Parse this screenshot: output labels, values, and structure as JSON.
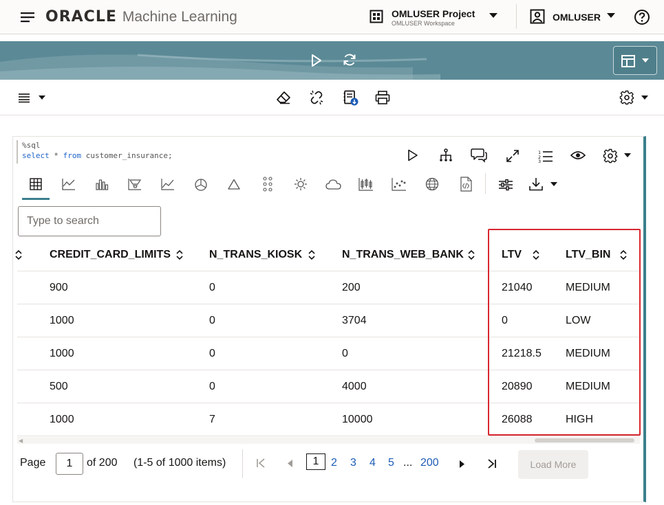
{
  "header": {
    "brand": "ORACLE",
    "product": "Machine Learning",
    "project_name": "OMLUSER Project",
    "workspace_name": "OMLUSER Workspace",
    "user_name": "OMLUSER"
  },
  "paragraph": {
    "code_line1": "%sql",
    "code_select": "select",
    "code_mid": " * ",
    "code_from": "from",
    "code_table": " customer_insurance;",
    "search_placeholder": "Type to search"
  },
  "table": {
    "columns": [
      "CREDIT_CARD_LIMITS",
      "N_TRANS_KIOSK",
      "N_TRANS_WEB_BANK",
      "LTV",
      "LTV_BIN"
    ],
    "rows": [
      [
        "900",
        "0",
        "200",
        "21040",
        "MEDIUM"
      ],
      [
        "1000",
        "0",
        "3704",
        "0",
        "LOW"
      ],
      [
        "1000",
        "0",
        "0",
        "21218.5",
        "MEDIUM"
      ],
      [
        "500",
        "0",
        "4000",
        "20890",
        "MEDIUM"
      ],
      [
        "1000",
        "7",
        "10000",
        "26088",
        "HIGH"
      ]
    ]
  },
  "pager": {
    "page_label": "Page",
    "page_value": "1",
    "of_label": "of 200",
    "items_label": "(1-5 of 1000 items)",
    "current": "1",
    "pages": [
      "2",
      "3",
      "4",
      "5"
    ],
    "ellipsis": "...",
    "last_page": "200",
    "load_more": "Load More"
  },
  "colors": {
    "accent": "#3a7f8c",
    "highlight": "#d7262e",
    "link": "#1d5cb6"
  }
}
